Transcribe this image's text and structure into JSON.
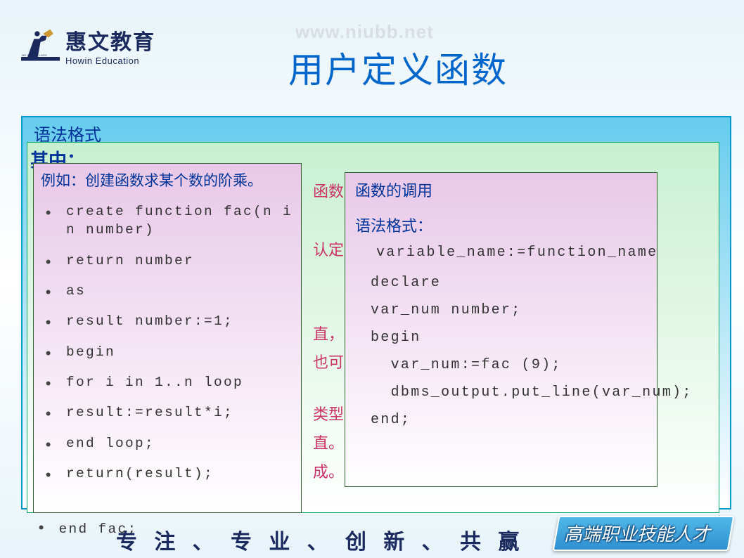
{
  "watermark": "www.niubb.net",
  "logo": {
    "cn": "惠文教育",
    "en": "Howin Education"
  },
  "title": "用户定义函数",
  "labels": {
    "syntax": "语法格式",
    "where": "其中："
  },
  "mid_text": {
    "t1": "函数",
    "t2": "认定",
    "t3": "直，可",
    "t3b": "也可以",
    "t4": "类型",
    "t5": "直。",
    "t6": "成。"
  },
  "left_box": {
    "title": "例如：创建函数求某个数的阶乘。",
    "code": [
      "create function fac(n in number)",
      "return number",
      "as",
      "  result number:=1;",
      "begin",
      "  for i in 1..n loop",
      "  result:=result*i;",
      "  end loop;",
      "  return(result);"
    ],
    "code_outside": "end fac;"
  },
  "right_box": {
    "title": "函数的调用",
    "syntax_label": "语法格式：",
    "line1": "variable_name:=function_name",
    "code": [
      "declare",
      "var_num number;",
      "begin",
      "  var_num:=fac (9);",
      "  dbms_output.put_line(var_num);",
      "end;"
    ]
  },
  "footer": {
    "slogan": "专 注 、 专 业 、 创 新 、 共 赢",
    "badge": "高端职业技能人才"
  }
}
